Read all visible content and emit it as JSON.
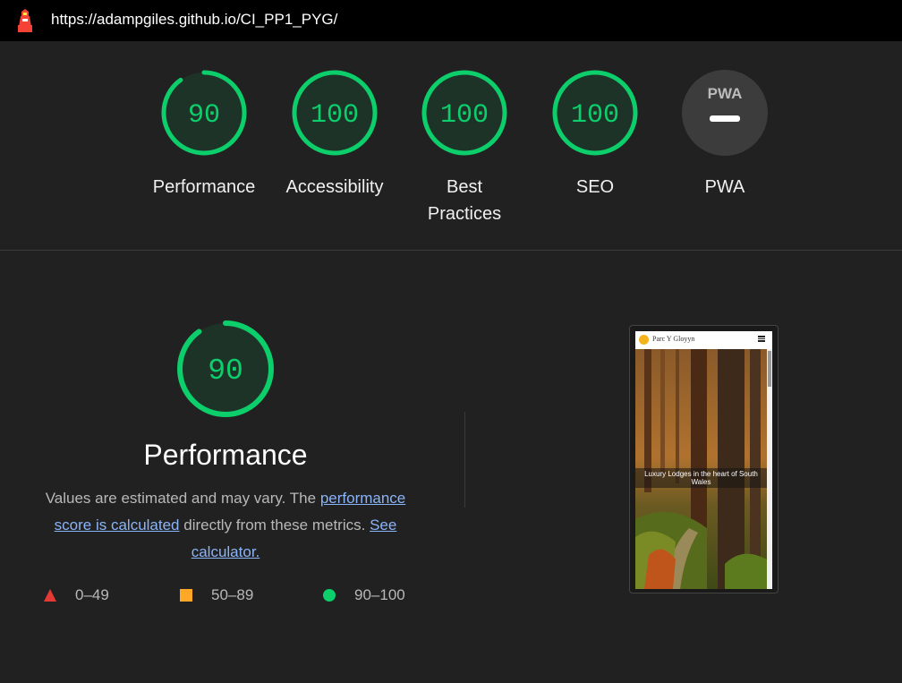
{
  "browser": {
    "url": "https://adampgiles.github.io/CI_PP1_PYG/",
    "logo_icon": "lighthouse-icon"
  },
  "summary_gauges": [
    {
      "label": "Performance",
      "score": "90",
      "fraction": 0.9
    },
    {
      "label": "Accessibility",
      "score": "100",
      "fraction": 1.0
    },
    {
      "label": "Best Practices",
      "score": "100",
      "fraction": 1.0
    },
    {
      "label": "SEO",
      "score": "100",
      "fraction": 1.0
    },
    {
      "label": "PWA",
      "score": "",
      "icon": "pwa-icon"
    }
  ],
  "performance": {
    "score": "90",
    "fraction": 0.9,
    "title": "Performance",
    "desc_prefix": "Values are estimated and may vary. The ",
    "link1": "performance score is calculated",
    "desc_middle": " directly from these metrics. ",
    "link2": "See calculator."
  },
  "legend": [
    {
      "range": "0–49",
      "shape": "triangle",
      "color": "#e53935"
    },
    {
      "range": "50–89",
      "shape": "square",
      "color": "#ffa726"
    },
    {
      "range": "90–100",
      "shape": "circle",
      "color": "#0cce6b"
    }
  ],
  "screenshot": {
    "brand": "Parc Y Gloyyn",
    "caption": "Luxury Lodges in the heart of South Wales"
  },
  "colors": {
    "pass": "#0cce6b",
    "pass_bg": "#1e3328",
    "pwa_bg": "#3c3c3c"
  }
}
